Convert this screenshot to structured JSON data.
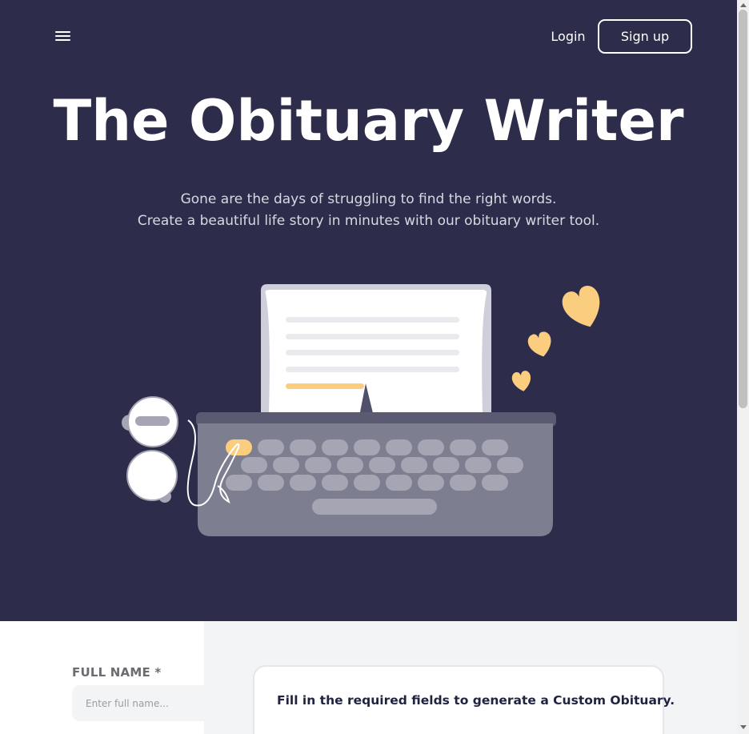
{
  "header": {
    "menu_icon": "hamburger-menu-icon",
    "login_label": "Login",
    "signup_label": "Sign up"
  },
  "hero": {
    "title": "The Obituary Writer",
    "subtitle_line1": "Gone are the days of struggling to find the right words.",
    "subtitle_line2": "Create a beautiful life story in minutes with our obituary writer tool.",
    "illustration": "typewriter-robot-hearts-illustration"
  },
  "form": {
    "full_name_label": "FULL NAME *",
    "full_name_placeholder": "Enter full name...",
    "full_name_value": ""
  },
  "result": {
    "message": "Fill in the required fields to generate a Custom Obituary."
  },
  "colors": {
    "hero_background": "#2d2d4b",
    "accent_heart": "#fbcd7e",
    "typewriter_body": "#7e7e91",
    "keys": "#a5a5b4",
    "page_background": "#f3f4f6"
  }
}
